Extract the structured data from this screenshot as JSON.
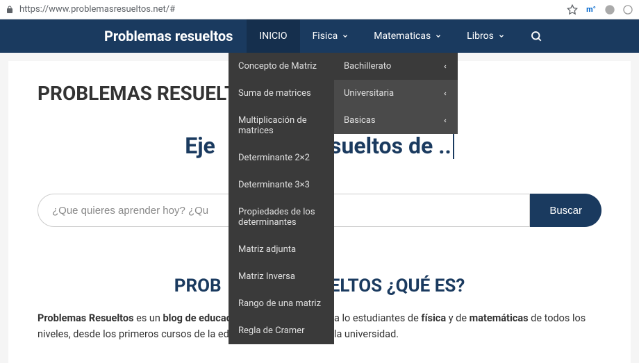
{
  "browser": {
    "url": "https://www.problemasresueltos.net/#",
    "movistar": "m°"
  },
  "nav": {
    "brand": "Problemas resueltos",
    "items": {
      "inicio": "INICIO",
      "fisica": "Fisica",
      "matematicas": "Matematicas",
      "libros": "Libros"
    }
  },
  "dropdown1": {
    "i0": "Concepto de Matriz",
    "i1": "Suma de matrices",
    "i2": "Multiplicación de matrices",
    "i3": "Determinante 2×2",
    "i4": "Determinante 3×3",
    "i5": "Propiedades de los determinantes",
    "i6": "Matriz adjunta",
    "i7": "Matriz Inversa",
    "i8": "Rango de una matriz",
    "i9": "Regla de Cramer"
  },
  "dropdown2": {
    "i0": "Bachillerato",
    "i1": "Universitaria",
    "i2": "Basicas"
  },
  "page": {
    "title": "PROBLEMAS RESUELTOS",
    "hero_prefix": "Eje",
    "hero_suffix": "sueltos de ..",
    "search_placeholder": "¿Que quieres aprender hoy? ¿Qu",
    "search_button": "Buscar",
    "section_prefix": "PROB",
    "section_suffix": "ELTOS ¿QUÉ ES?",
    "intro_b1": "Problemas Resueltos",
    "intro_t1": " es un ",
    "intro_b2": "blog de educación y ciencia",
    "intro_t2": " dedicado a lo estudiantes de ",
    "intro_b3": "física",
    "intro_t3": " y de ",
    "intro_b4": "matemáticas",
    "intro_t4": " de todos los niveles, desde los primeros cursos de la educacion primaria hasta la universidad."
  }
}
